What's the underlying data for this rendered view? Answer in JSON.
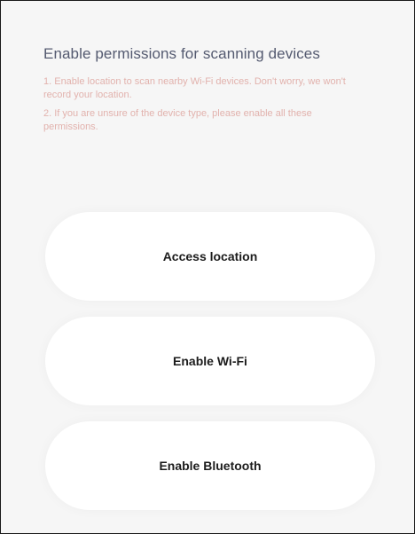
{
  "header": {
    "title": "Enable permissions for scanning devices",
    "descriptions": [
      "1. Enable location to scan nearby Wi-Fi devices. Don't worry, we won't record your location.",
      "2. If you are unsure of the device type, please enable all these permissions."
    ]
  },
  "actions": {
    "location_label": "Access location",
    "wifi_label": "Enable Wi-Fi",
    "bluetooth_label": "Enable Bluetooth"
  },
  "colors": {
    "background": "#f6f6f6",
    "title": "#545a70",
    "description": "#e2b2ad",
    "button": "#ffffff",
    "button_text": "#1c1c1c"
  }
}
